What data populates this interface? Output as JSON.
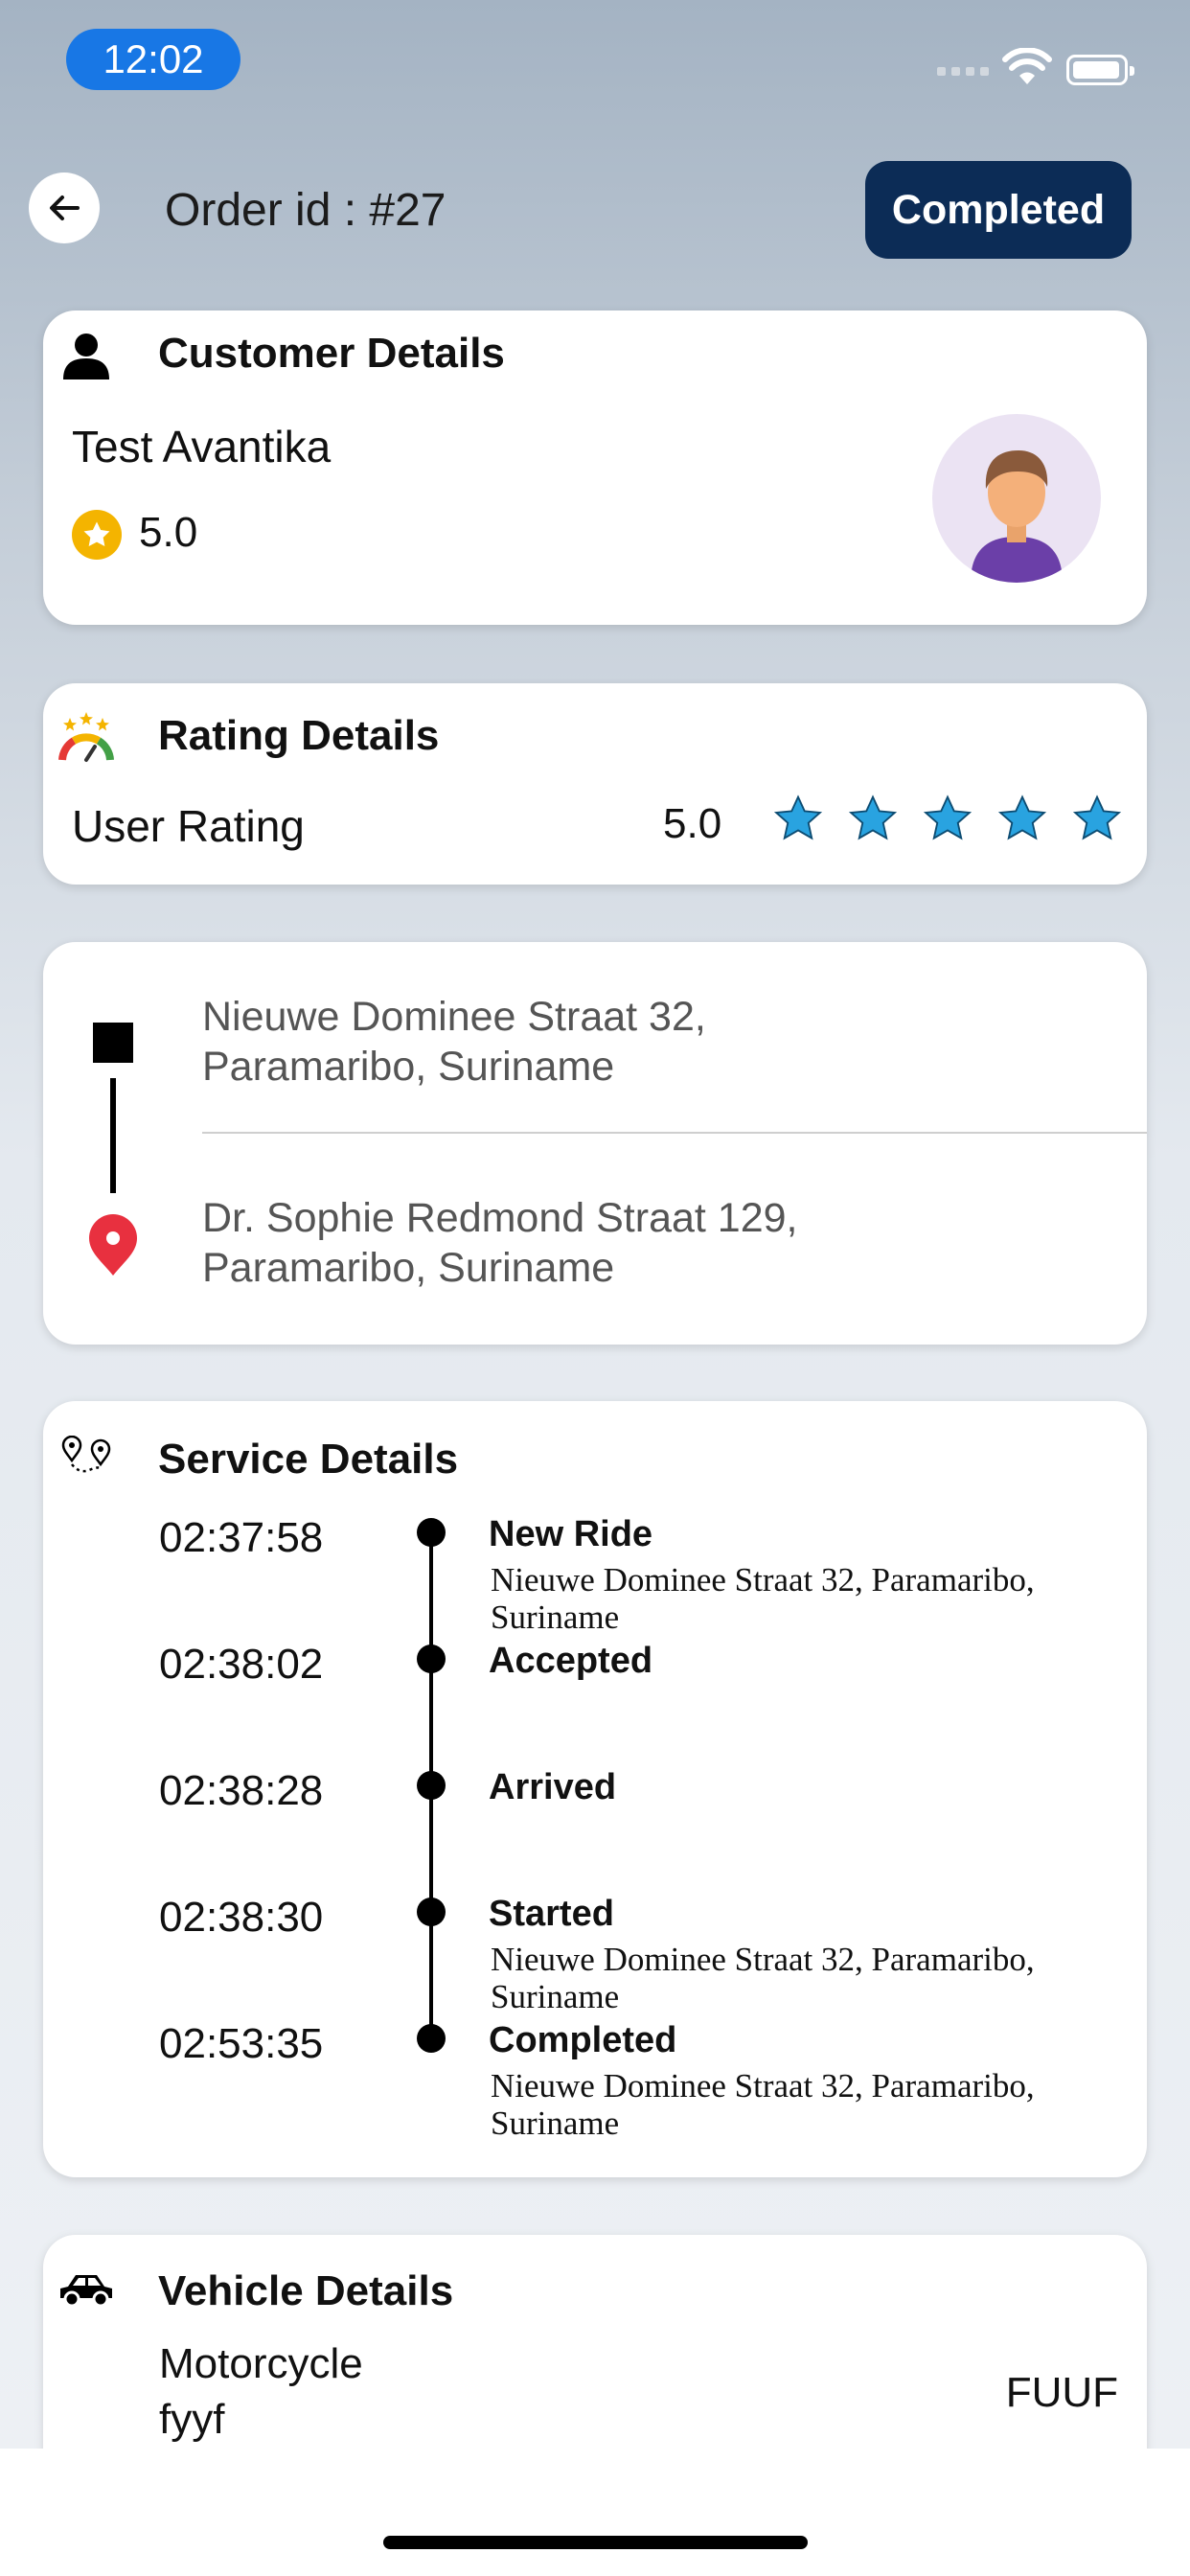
{
  "status_bar": {
    "time": "12:02"
  },
  "header": {
    "order_title": "Order id : #27",
    "status_label": "Completed"
  },
  "customer": {
    "section_title": "Customer Details",
    "name": "Test Avantika",
    "rating": "5.0"
  },
  "rating": {
    "section_title": "Rating Details",
    "label": "User Rating",
    "value": "5.0",
    "stars": 5
  },
  "route": {
    "pickup_line1": "Nieuwe Dominee Straat 32,",
    "pickup_line2": "Paramaribo, Suriname",
    "dropoff_line1": "Dr. Sophie Redmond Straat 129,",
    "dropoff_line2": "Paramaribo, Suriname"
  },
  "service": {
    "section_title": "Service Details",
    "events": [
      {
        "time": "02:37:58",
        "title": "New Ride",
        "address": "Nieuwe Dominee Straat 32, Paramaribo, Suriname"
      },
      {
        "time": "02:38:02",
        "title": "Accepted",
        "address": ""
      },
      {
        "time": "02:38:28",
        "title": "Arrived",
        "address": ""
      },
      {
        "time": "02:38:30",
        "title": "Started",
        "address": "Nieuwe Dominee Straat 32, Paramaribo, Suriname"
      },
      {
        "time": "02:53:35",
        "title": "Completed",
        "address": "Nieuwe Dominee Straat 32, Paramaribo, Suriname"
      }
    ]
  },
  "vehicle": {
    "section_title": "Vehicle Details",
    "type": "Motorcycle",
    "model": "fyyf",
    "plate": "FUUF"
  },
  "colors": {
    "status_button": "#0c2c56",
    "time_pill": "#1877e5",
    "star": "#29a3e0",
    "pin": "#e8303f"
  }
}
